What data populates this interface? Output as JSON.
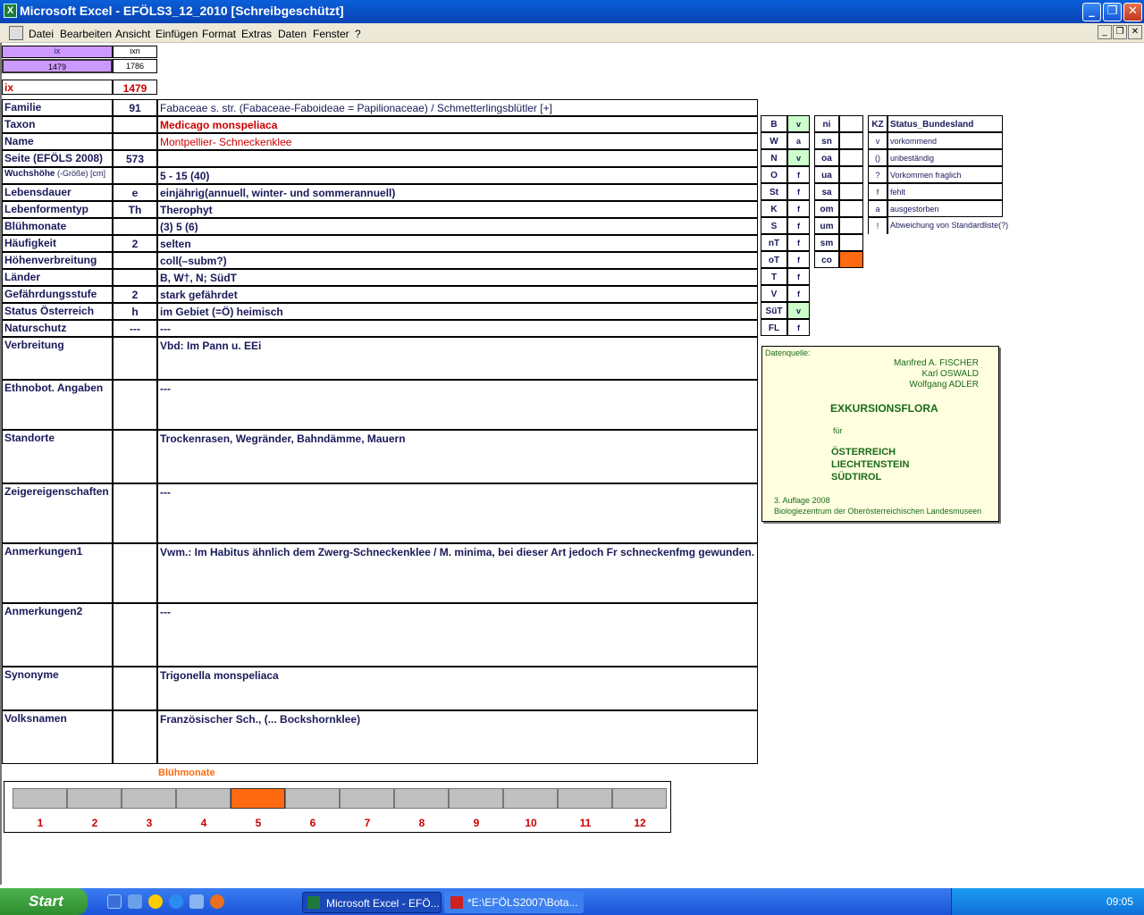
{
  "window": {
    "title": "Microsoft Excel - EFÖLS3_12_2010  [Schreibgeschützt]",
    "app_icon": "excel-icon"
  },
  "menu": [
    "Datei",
    "Bearbeiten",
    "Ansicht",
    "Einfügen",
    "Format",
    "Extras",
    "Daten",
    "Fenster",
    "?"
  ],
  "top": {
    "ix_header": "ix",
    "ixn_header": "ixn",
    "ix_value": "1479",
    "ixn_value": "1786",
    "ix_label": "ix",
    "ix_big": "1479"
  },
  "rows": [
    {
      "label": "Familie",
      "num": "91",
      "value": "Fabaceae s. str. (Fabaceae-Faboideae = Papilionaceae)  /  Schmetterlingsblütler [+]"
    },
    {
      "label": "Taxon",
      "num": "",
      "value": "Medicago monspeliaca"
    },
    {
      "label": "Name",
      "num": "",
      "value": "Montpellier- Schneckenklee"
    },
    {
      "label": "Seite (EFÖLS 2008)",
      "num": "573",
      "value": ""
    },
    {
      "label": "Wuchshöhe",
      "label_suffix": "(-Größe) [cm]",
      "num": "",
      "value": " 5 - 15 (40)"
    },
    {
      "label": "Lebensdauer",
      "num": "e",
      "value": "einjährig(annuell, winter- und sommerannuell)"
    },
    {
      "label": "Lebenformentyp",
      "num": "Th",
      "value": "Therophyt"
    },
    {
      "label": "Blühmonate",
      "num": "",
      "value": "(3) 5 (6)"
    },
    {
      "label": "Häufigkeit",
      "num": "2",
      "value": "selten"
    },
    {
      "label": "Höhenverbreitung",
      "num": "",
      "value": "coll(–subm?)"
    },
    {
      "label": "Länder",
      "num": "",
      "value": "B, W†, N; SüdT"
    },
    {
      "label": "Gefährdungsstufe",
      "num": "2",
      "value": "stark gefährdet"
    },
    {
      "label": "Status Österreich",
      "num": "h",
      "value": "im Gebiet (=Ö) heimisch"
    },
    {
      "label": "Naturschutz",
      "num": "---",
      "value": " ---"
    },
    {
      "label": "Verbreitung",
      "num": "",
      "value": "Vbd:  Im Pann u. EEi"
    },
    {
      "label": "Ethnobot. Angaben",
      "num": "",
      "value": "---"
    },
    {
      "label": "Standorte",
      "num": "",
      "value": "Trockenrasen, Wegränder, Bahndämme, Mauern"
    },
    {
      "label": "Zeigereigenschaften",
      "num": "",
      "value": "---"
    },
    {
      "label": "Anmerkungen1",
      "num": "",
      "value": "Vwm.: Im Habitus ähnlich dem Zwerg-Schneckenklee / M. minima, bei dieser Art jedoch Fr schneckenfmg gewunden."
    },
    {
      "label": "Anmerkungen2",
      "num": "",
      "value": "---"
    },
    {
      "label": "Synonyme",
      "num": "",
      "value": "Trigonella monspeliaca"
    },
    {
      "label": "Volksnamen",
      "num": "",
      "value": "Französischer Sch., (... Bockshornklee)"
    }
  ],
  "regions": [
    {
      "code": "B",
      "status": "v",
      "highlight": true
    },
    {
      "code": "W",
      "status": "a",
      "highlight": false
    },
    {
      "code": "N",
      "status": "v",
      "highlight": true
    },
    {
      "code": "O",
      "status": "f",
      "highlight": false
    },
    {
      "code": "St",
      "status": "f",
      "highlight": false
    },
    {
      "code": "K",
      "status": "f",
      "highlight": false
    },
    {
      "code": "S",
      "status": "f",
      "highlight": false
    },
    {
      "code": "nT",
      "status": "f",
      "highlight": false
    },
    {
      "code": "oT",
      "status": "f",
      "highlight": false
    },
    {
      "code": "T",
      "status": "f",
      "highlight": false
    },
    {
      "code": "V",
      "status": "f",
      "highlight": false
    },
    {
      "code": "SüT",
      "status": "v",
      "highlight": true
    },
    {
      "code": "FL",
      "status": "f",
      "highlight": false
    }
  ],
  "altitude": [
    {
      "code": "ni",
      "mark": false
    },
    {
      "code": "sn",
      "mark": false
    },
    {
      "code": "oa",
      "mark": false
    },
    {
      "code": "ua",
      "mark": false
    },
    {
      "code": "sa",
      "mark": false
    },
    {
      "code": "om",
      "mark": false
    },
    {
      "code": "um",
      "mark": false
    },
    {
      "code": "sm",
      "mark": false
    },
    {
      "code": "co",
      "mark": true
    }
  ],
  "legend": {
    "kz_header": "KZ",
    "status_header": "Status_Bundesland",
    "items": [
      {
        "kz": "v",
        "text": "vorkommend"
      },
      {
        "kz": "()",
        "text": "unbeständig"
      },
      {
        "kz": "?",
        "text": "Vorkommen fraglich"
      },
      {
        "kz": "f",
        "text": "fehlt"
      },
      {
        "kz": "a",
        "text": "ausgestorben"
      },
      {
        "kz": "!",
        "text": "Abweichung von Standardliste(?)"
      }
    ]
  },
  "datenquelle": {
    "label": "Datenquelle:",
    "authors": [
      "Manfred A. FISCHER",
      "Karl OSWALD",
      "Wolfgang ADLER"
    ],
    "title": "EXKURSIONSFLORA",
    "fuer": "für",
    "countries": [
      "ÖSTERREICH",
      "LIECHTENSTEIN",
      "SÜDTIROL"
    ],
    "edition": "3. Auflage 2008",
    "publisher": "Biologiezentrum der Oberösterreichischen Landesmuseen"
  },
  "bluehmonate": {
    "title": "Blühmonate",
    "months": [
      "1",
      "2",
      "3",
      "4",
      "5",
      "6",
      "7",
      "8",
      "9",
      "10",
      "11",
      "12"
    ],
    "active": [
      false,
      false,
      false,
      false,
      true,
      false,
      false,
      false,
      false,
      false,
      false,
      false
    ]
  },
  "taskbar": {
    "start": "Start",
    "tasks": [
      "Microsoft Excel - EFÖ...",
      "*E:\\EFÖLS2007\\Bota..."
    ],
    "clock": "09:05"
  },
  "colors": {
    "highlight_green": "#ccffcc",
    "accent_orange": "#ff6a10",
    "label_navy": "#1a1a5a",
    "value_red": "#cc0000"
  }
}
